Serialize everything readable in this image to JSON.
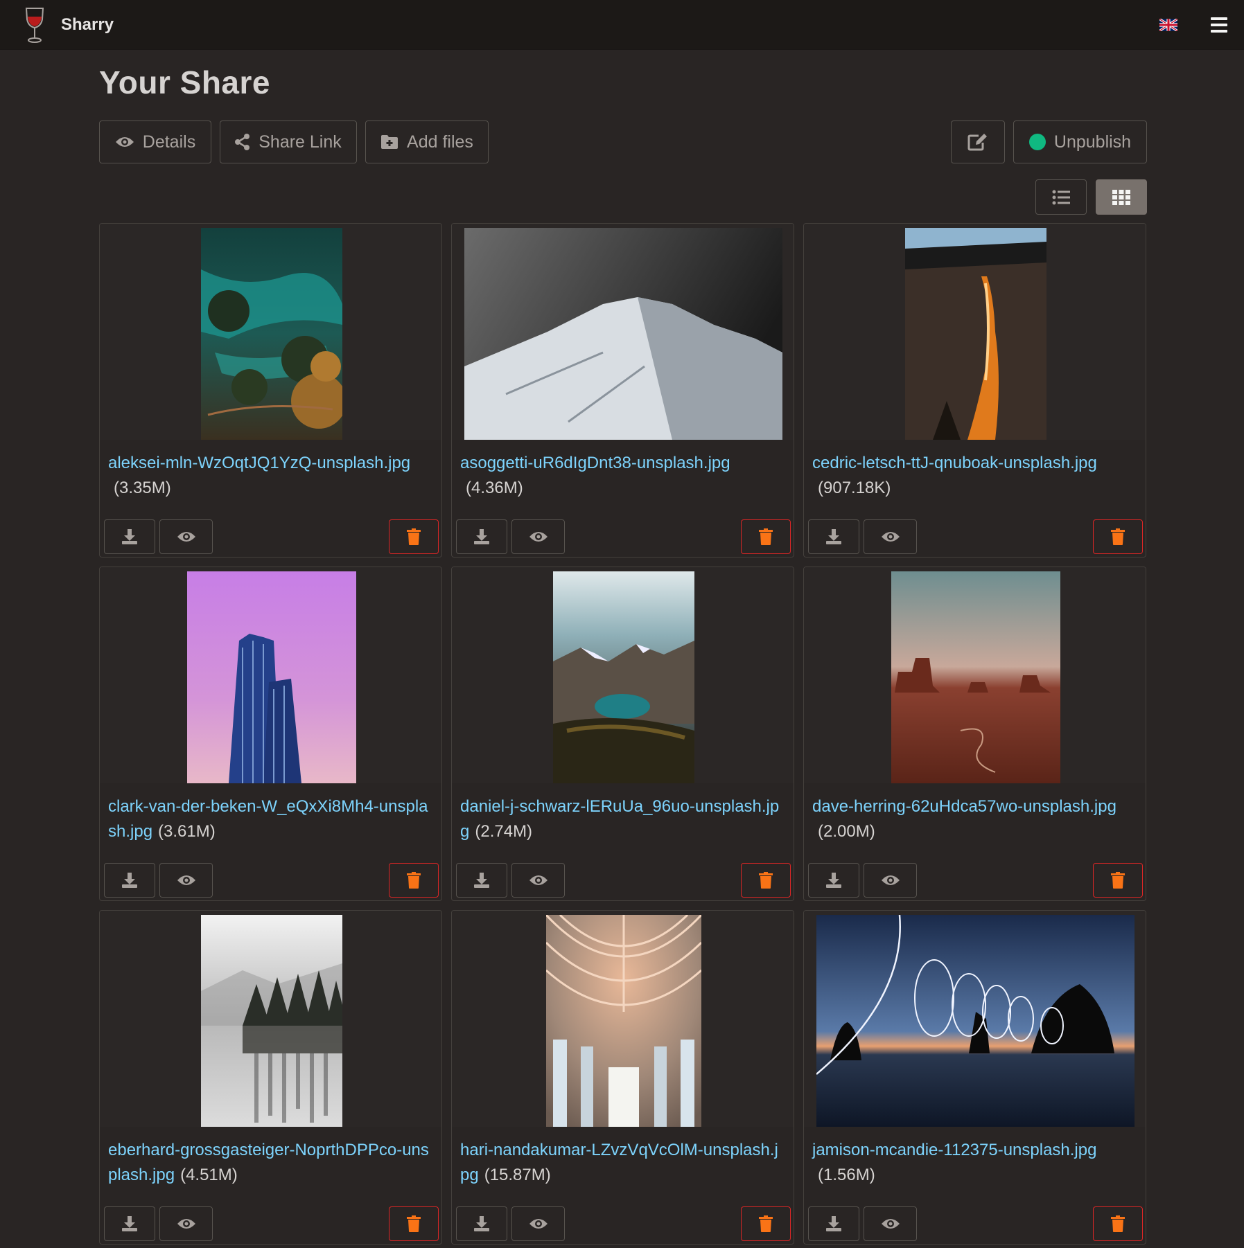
{
  "app": {
    "name": "Sharry"
  },
  "page": {
    "title": "Your Share"
  },
  "toolbar": {
    "details_label": "Details",
    "share_link_label": "Share Link",
    "add_files_label": "Add files",
    "unpublish_label": "Unpublish"
  },
  "view_mode": "grid",
  "colors": {
    "accent_link": "#7dd3fc",
    "delete": "#f97316",
    "published_dot": "#10b981",
    "background": "#292524"
  },
  "files": [
    {
      "name": "aleksei-mln-WzOqtJQ1YzQ-unsplash.jpg",
      "size": "(3.35M)"
    },
    {
      "name": "asoggetti-uR6dIgDnt38-unsplash.jpg",
      "size": "(4.36M)"
    },
    {
      "name": "cedric-letsch-ttJ-qnuboak-unsplash.jpg",
      "size": "(907.18K)"
    },
    {
      "name": "clark-van-der-beken-W_eQxXi8Mh4-unsplash.jpg",
      "size": "(3.61M)"
    },
    {
      "name": "daniel-j-schwarz-lERuUa_96uo-unsplash.jpg",
      "size": "(2.74M)"
    },
    {
      "name": "dave-herring-62uHdca57wo-unsplash.jpg",
      "size": "(2.00M)"
    },
    {
      "name": "eberhard-grossgasteiger-NoprthDPPco-unsplash.jpg",
      "size": "(4.51M)"
    },
    {
      "name": "hari-nandakumar-LZvzVqVcOlM-unsplash.jpg",
      "size": "(15.87M)"
    },
    {
      "name": "jamison-mcandie-112375-unsplash.jpg",
      "size": "(1.56M)"
    }
  ]
}
